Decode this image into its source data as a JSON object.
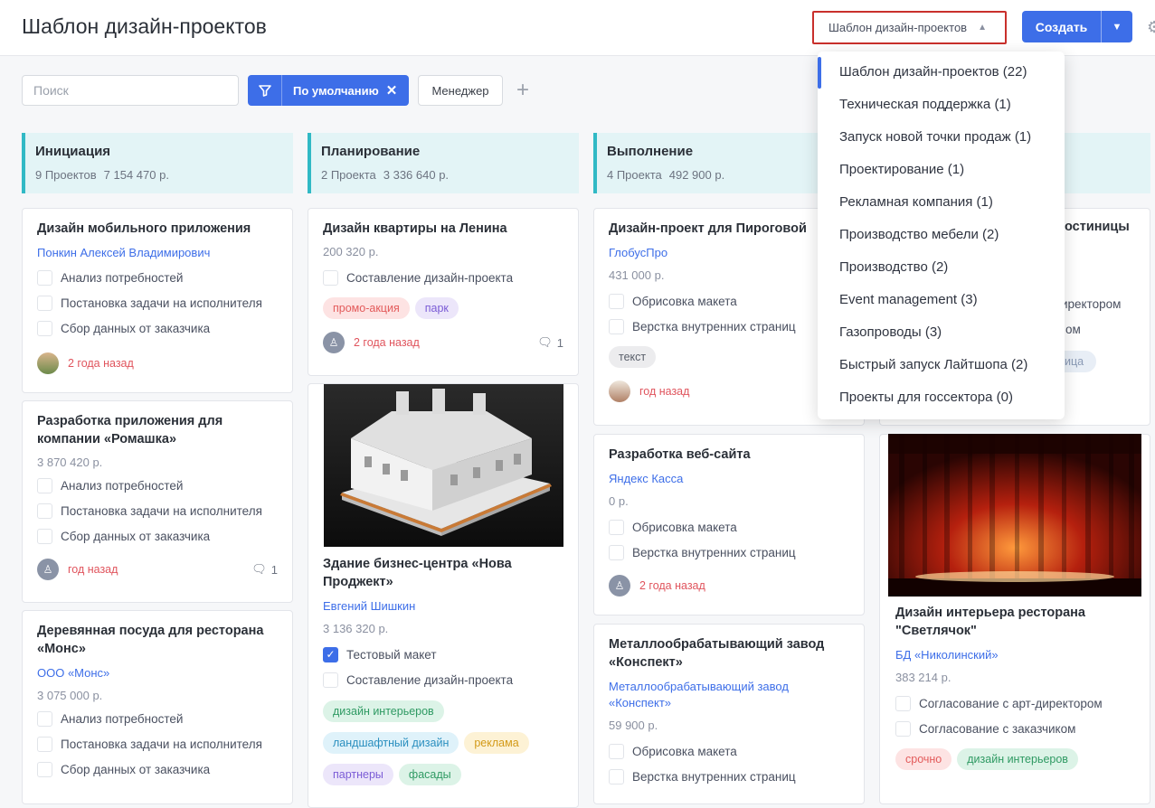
{
  "header": {
    "title": "Шаблон дизайн-проектов",
    "template_select": "Шаблон дизайн-проектов",
    "create_label": "Создать"
  },
  "toolbar": {
    "search_placeholder": "Поиск",
    "filter_label": "По умолчанию",
    "manager_label": "Менеджер"
  },
  "columns": [
    {
      "title": "Инициация",
      "count": "9 Проектов",
      "sum": "7 154 470 р."
    },
    {
      "title": "Планирование",
      "count": "2 Проекта",
      "sum": "3 336 640 р."
    },
    {
      "title": "Выполнение",
      "count": "4 Проекта",
      "sum": "492 900 р."
    }
  ],
  "cards": {
    "c1": {
      "title": "Дизайн мобильного приложения",
      "link": "Понкин Алексей Владимирович",
      "tasks": [
        "Анализ потребностей",
        "Постановка задачи на исполнителя",
        "Сбор данных от заказчика"
      ],
      "time": "2 года назад"
    },
    "c2": {
      "title": "Разработка приложения для компании «Ромашка»",
      "sum": "3 870 420 р.",
      "tasks": [
        "Анализ потребностей",
        "Постановка задачи на исполнителя",
        "Сбор данных от заказчика"
      ],
      "time": "год назад",
      "comments": "1"
    },
    "c3": {
      "title": "Деревянная посуда для ресторана «Монс»",
      "link": "ООО «Монс»",
      "sum": "3 075 000 р.",
      "tasks": [
        "Анализ потребностей",
        "Постановка задачи на исполнителя",
        "Сбор данных от заказчика"
      ]
    },
    "c4": {
      "title": "Дизайн квартиры на Ленина",
      "sum": "200 320 р.",
      "tasks": [
        "Составление дизайн-проекта"
      ],
      "tags": [
        "промо-акция",
        "парк"
      ],
      "time": "2 года назад",
      "comments": "1"
    },
    "c5": {
      "title": "Здание бизнес-центра «Нова Проджект»",
      "link": "Евгений Шишкин",
      "sum": "3 136 320 р.",
      "tasks": [
        "Тестовый макет",
        "Составление дизайн-проекта"
      ],
      "tags": [
        "дизайн интерьеров",
        "ландшафтный дизайн",
        "реклама",
        "партнеры",
        "фасады"
      ]
    },
    "c6": {
      "title": "Дизайн-проект для Пироговой",
      "link": "ГлобусПро",
      "sum": "431 000 р.",
      "tasks": [
        "Обрисовка макета",
        "Верстка внутренних страниц"
      ],
      "tags": [
        "текст"
      ],
      "time": "год назад"
    },
    "c7": {
      "title": "Разработка веб-сайта",
      "link": "Яндекс Касса",
      "sum": "0 р.",
      "tasks": [
        "Обрисовка макета",
        "Верстка внутренних страниц"
      ],
      "time": "2 года назад"
    },
    "c8": {
      "title": "Металлообрабатывающий завод «Конспект»",
      "link": "Металлообрабатывающий завод «Конспект»",
      "sum": "59 900 р.",
      "tasks": [
        "Обрисовка макета",
        "Верстка внутренних страниц"
      ]
    },
    "c9": {
      "title_frag": "остиницы",
      "task_frag1": "иректором",
      "task_frag2": "ом",
      "tag_frag": "ица"
    },
    "c10": {
      "title": "Дизайн интерьера ресторана \"Светлячок\"",
      "link": "БД «Николинский»",
      "sum": "383 214 р.",
      "tasks": [
        "Согласование с арт-директором",
        "Согласование с заказчиком"
      ],
      "tags": [
        "срочно",
        "дизайн интерьеров"
      ]
    }
  },
  "dropdown": {
    "items": [
      "Шаблон дизайн-проектов (22)",
      "Техническая поддержка (1)",
      "Запуск новой точки продаж (1)",
      "Проектирование (1)",
      "Рекламная компания (1)",
      "Производство мебели (2)",
      "Производство (2)",
      "Event management (3)",
      "Газопроводы (3)",
      "Быстрый запуск Лайтшопа (2)",
      "Проекты для госсектора (0)"
    ]
  }
}
